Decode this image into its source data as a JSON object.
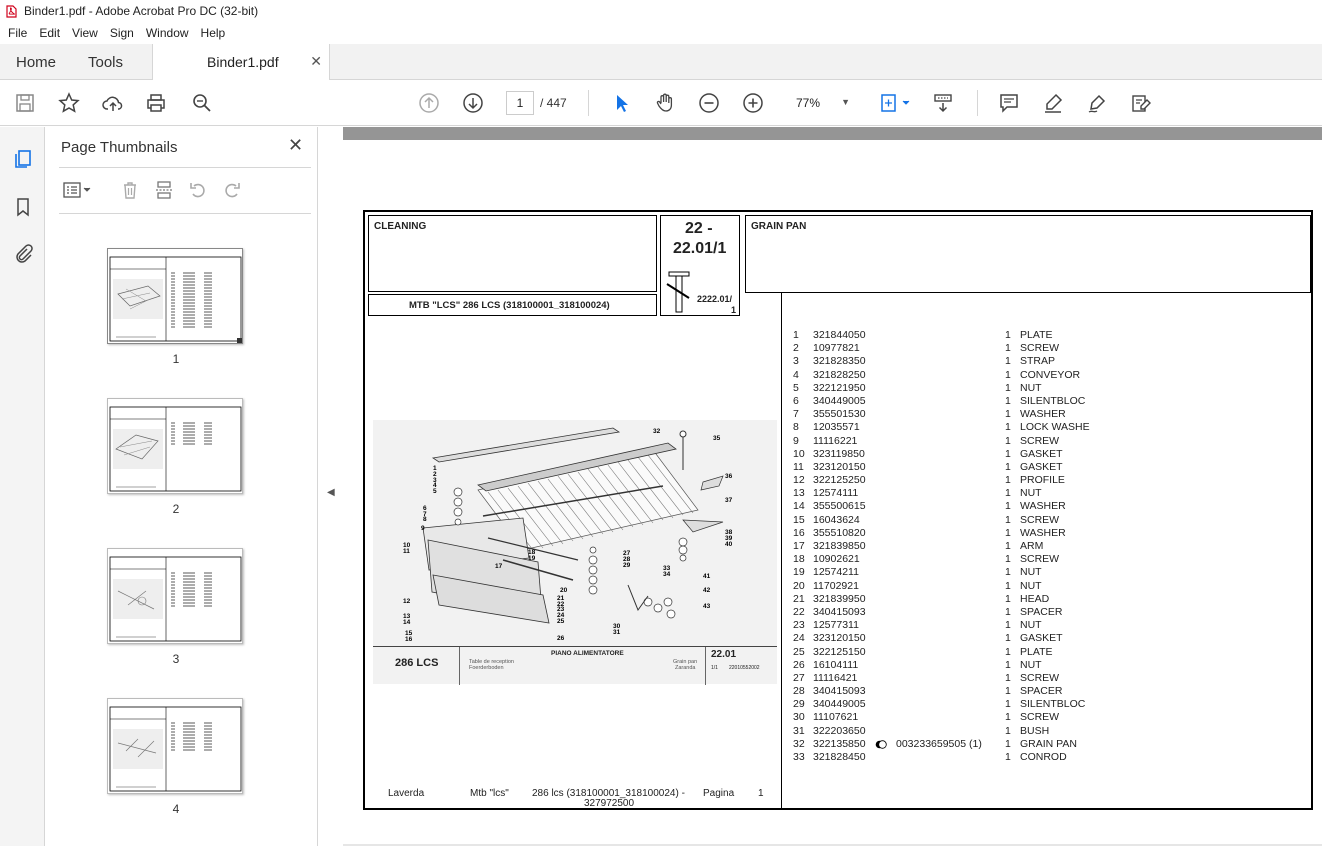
{
  "window": {
    "title": "Binder1.pdf - Adobe Acrobat Pro DC (32-bit)"
  },
  "menu": [
    "File",
    "Edit",
    "View",
    "Sign",
    "Window",
    "Help"
  ],
  "tabs": {
    "home": "Home",
    "tools": "Tools",
    "document": "Binder1.pdf"
  },
  "toolbar": {
    "current_page": "1",
    "total_pages": "/ 447",
    "zoom": "77%"
  },
  "panel": {
    "title": "Page Thumbnails",
    "thumbnails": [
      {
        "label": "1"
      },
      {
        "label": "2"
      },
      {
        "label": "3"
      },
      {
        "label": "4"
      }
    ]
  },
  "document": {
    "section": "CLEANING",
    "code_top": "22 -",
    "code_bottom": "22.01/1",
    "model": "MTB \"LCS\" 286 LCS (318100001_318100024)",
    "group_title": "GRAIN PAN",
    "small_ref": "2222.01/",
    "small_ref2": "1",
    "drawing": {
      "model_label": "286 LCS",
      "title": "PIANO ALIMENTATORE",
      "subtitles": [
        "Table de reception",
        "Foerderboden"
      ],
      "subtitles_right": [
        "Grain pan",
        "Zaranda"
      ],
      "ref": "22.01",
      "sheet": "1/1",
      "drawing_no": "22010552002"
    },
    "parts": [
      {
        "pos": "1",
        "code": "321844050",
        "note": "",
        "qty": "1",
        "desc": "PLATE"
      },
      {
        "pos": "2",
        "code": "10977821",
        "note": "",
        "qty": "1",
        "desc": "SCREW"
      },
      {
        "pos": "3",
        "code": "321828350",
        "note": "",
        "qty": "1",
        "desc": "STRAP"
      },
      {
        "pos": "4",
        "code": "321828250",
        "note": "",
        "qty": "1",
        "desc": "CONVEYOR"
      },
      {
        "pos": "5",
        "code": "322121950",
        "note": "",
        "qty": "1",
        "desc": "NUT"
      },
      {
        "pos": "6",
        "code": "340449005",
        "note": "",
        "qty": "1",
        "desc": "SILENTBLOC"
      },
      {
        "pos": "7",
        "code": "355501530",
        "note": "",
        "qty": "1",
        "desc": "WASHER"
      },
      {
        "pos": "8",
        "code": "12035571",
        "note": "",
        "qty": "1",
        "desc": "LOCK WASHE"
      },
      {
        "pos": "9",
        "code": "11116221",
        "note": "",
        "qty": "1",
        "desc": "SCREW"
      },
      {
        "pos": "10",
        "code": "323119850",
        "note": "",
        "qty": "1",
        "desc": "GASKET"
      },
      {
        "pos": "11",
        "code": "323120150",
        "note": "",
        "qty": "1",
        "desc": "GASKET"
      },
      {
        "pos": "12",
        "code": "322125250",
        "note": "",
        "qty": "1",
        "desc": "PROFILE"
      },
      {
        "pos": "13",
        "code": "12574111",
        "note": "",
        "qty": "1",
        "desc": "NUT"
      },
      {
        "pos": "14",
        "code": "355500615",
        "note": "",
        "qty": "1",
        "desc": "WASHER"
      },
      {
        "pos": "15",
        "code": "16043624",
        "note": "",
        "qty": "1",
        "desc": "SCREW"
      },
      {
        "pos": "16",
        "code": "355510820",
        "note": "",
        "qty": "1",
        "desc": "WASHER"
      },
      {
        "pos": "17",
        "code": "321839850",
        "note": "",
        "qty": "1",
        "desc": "ARM"
      },
      {
        "pos": "18",
        "code": "10902621",
        "note": "",
        "qty": "1",
        "desc": "SCREW"
      },
      {
        "pos": "19",
        "code": "12574211",
        "note": "",
        "qty": "1",
        "desc": "NUT"
      },
      {
        "pos": "20",
        "code": "11702921",
        "note": "",
        "qty": "1",
        "desc": "NUT"
      },
      {
        "pos": "21",
        "code": "321839950",
        "note": "",
        "qty": "1",
        "desc": "HEAD"
      },
      {
        "pos": "22",
        "code": "340415093",
        "note": "",
        "qty": "1",
        "desc": "SPACER"
      },
      {
        "pos": "23",
        "code": "12577311",
        "note": "",
        "qty": "1",
        "desc": "NUT"
      },
      {
        "pos": "24",
        "code": "323120150",
        "note": "",
        "qty": "1",
        "desc": "GASKET"
      },
      {
        "pos": "25",
        "code": "322125150",
        "note": "",
        "qty": "1",
        "desc": "PLATE"
      },
      {
        "pos": "26",
        "code": "16104111",
        "note": "",
        "qty": "1",
        "desc": "NUT"
      },
      {
        "pos": "27",
        "code": "11116421",
        "note": "",
        "qty": "1",
        "desc": "SCREW"
      },
      {
        "pos": "28",
        "code": "340415093",
        "note": "",
        "qty": "1",
        "desc": "SPACER"
      },
      {
        "pos": "29",
        "code": "340449005",
        "note": "",
        "qty": "1",
        "desc": "SILENTBLOC"
      },
      {
        "pos": "30",
        "code": "11107621",
        "note": "",
        "qty": "1",
        "desc": "SCREW"
      },
      {
        "pos": "31",
        "code": "322203650",
        "note": "",
        "qty": "1",
        "desc": "BUSH"
      },
      {
        "pos": "32",
        "code": "322135850",
        "note": "003233659505  (1)",
        "qty": "1",
        "desc": "GRAIN PAN"
      },
      {
        "pos": "33",
        "code": "321828450",
        "note": "",
        "qty": "1",
        "desc": "CONROD"
      }
    ],
    "footer": {
      "brand": "Laverda",
      "model": "Mtb \"lcs\"",
      "range": "286 lcs (318100001_318100024) -",
      "range2": "327972500",
      "page_label": "Pagina",
      "page_no": "1"
    }
  }
}
